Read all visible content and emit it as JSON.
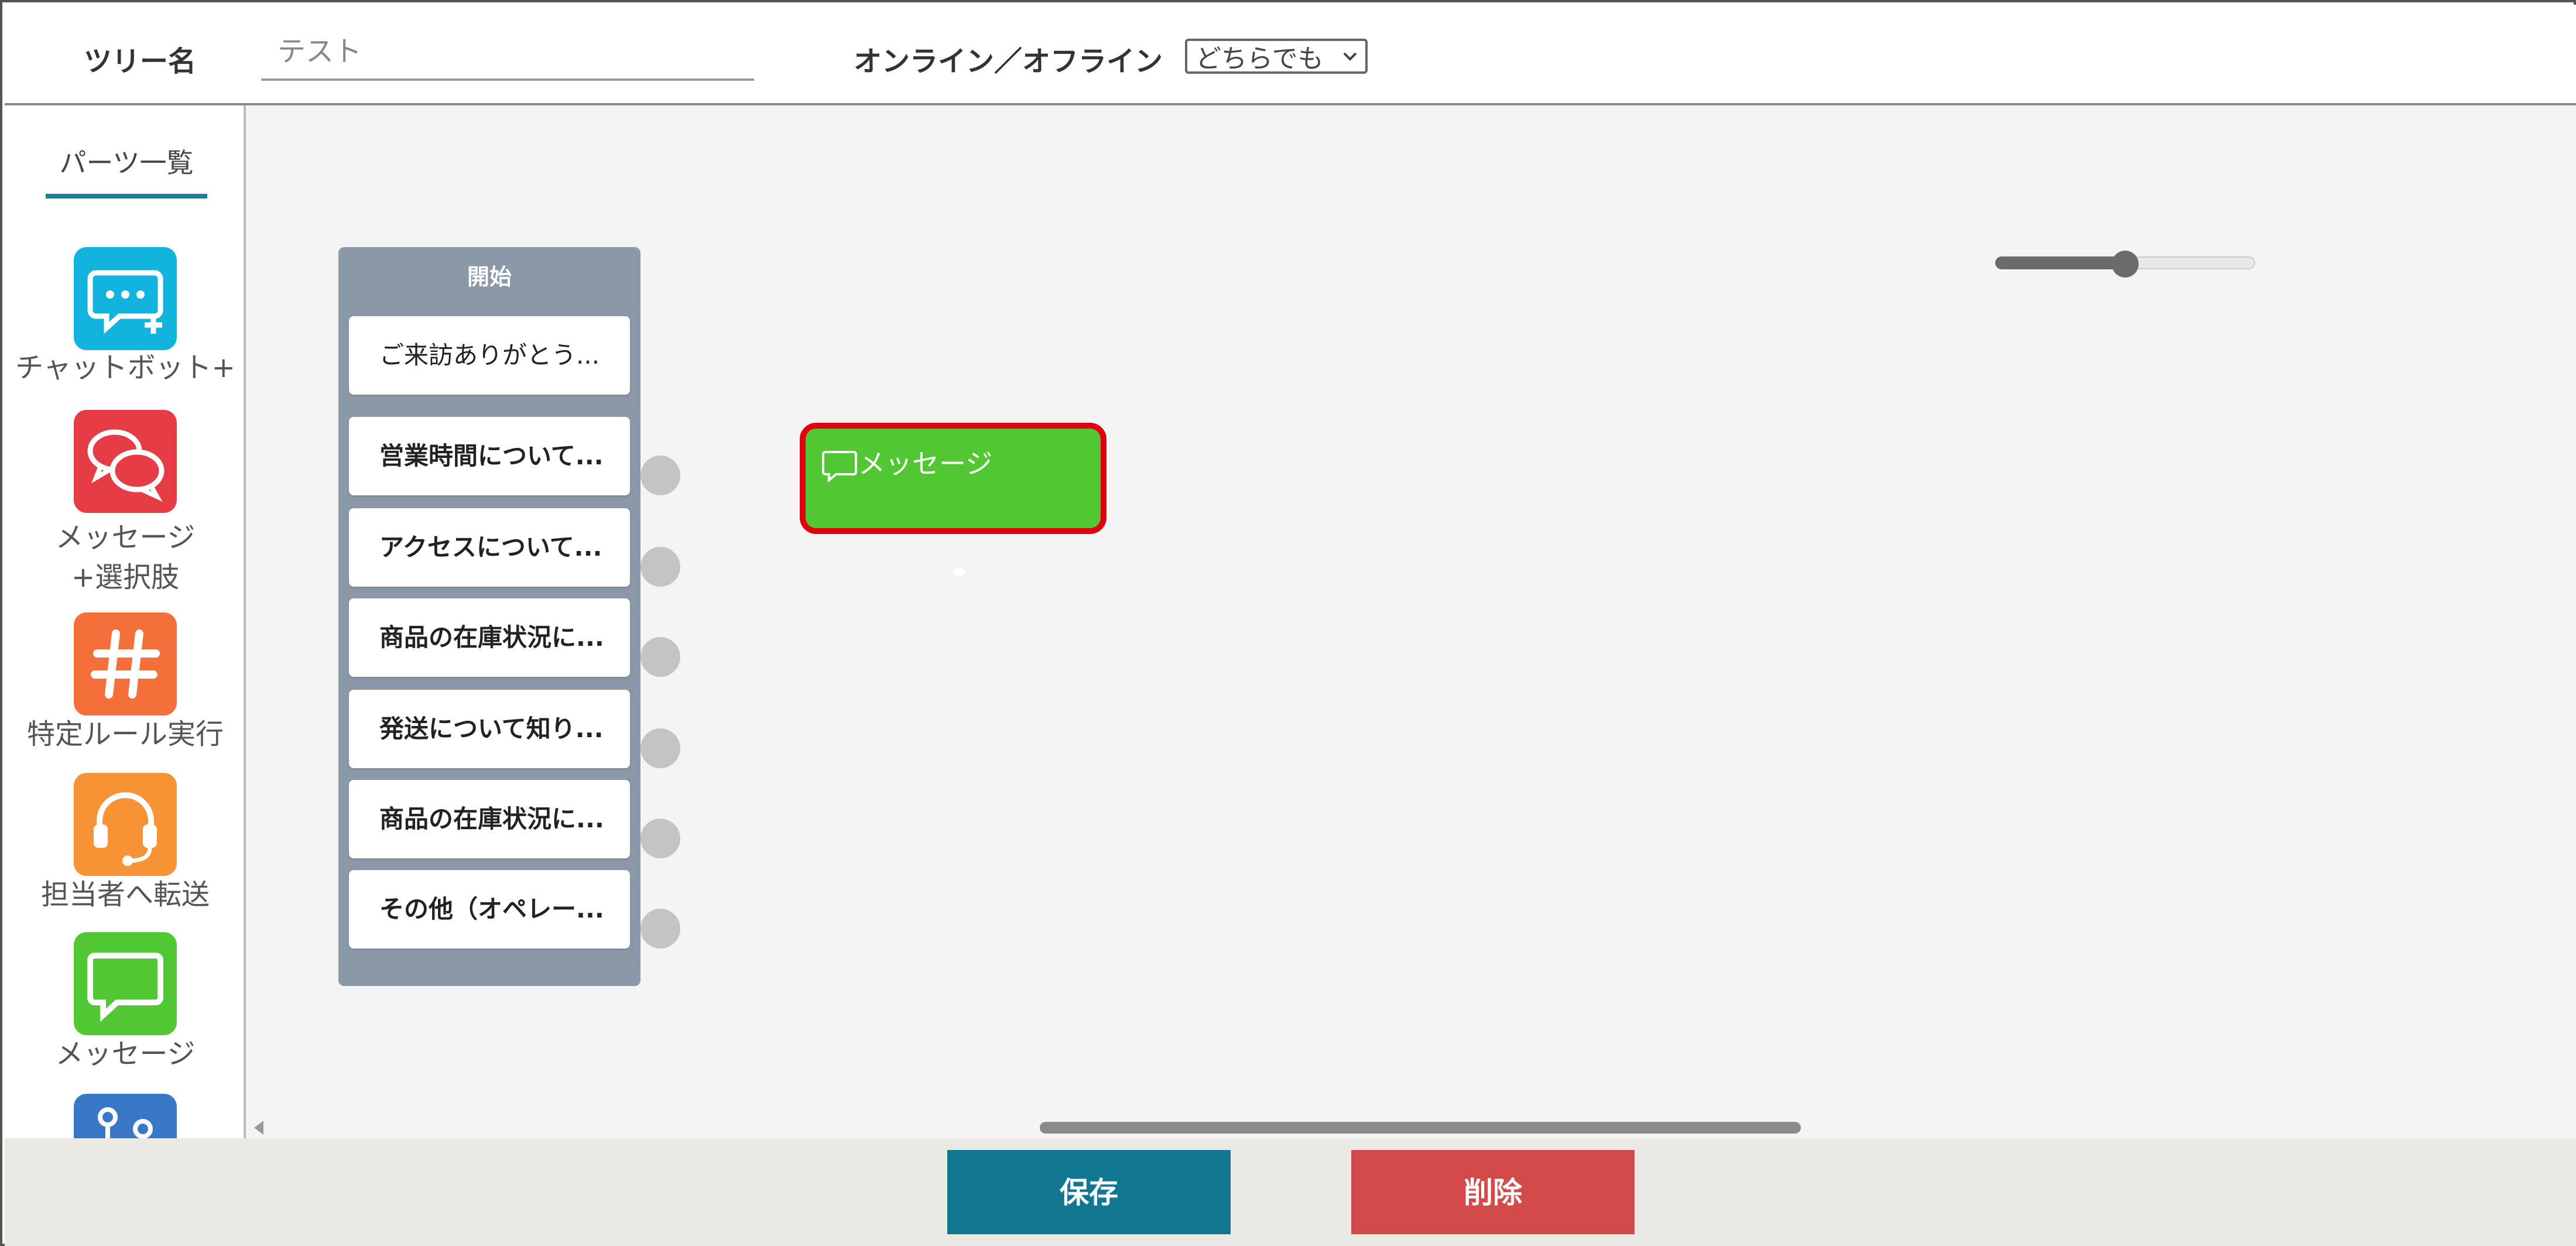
{
  "header": {
    "tree_name_label": "ツリー名",
    "tree_name_placeholder": "テスト",
    "online_label": "オンライン／オフライン",
    "online_select_value": "どちらでも"
  },
  "sidebar": {
    "title": "パーツ一覧",
    "items": [
      {
        "label": "チャットボット+",
        "icon": "chatbot-plus-icon",
        "color": "#12b4dd"
      },
      {
        "label_line1": "メッセージ",
        "label_line2": "+選択肢",
        "icon": "message-choice-icon",
        "color": "#e53c46"
      },
      {
        "label": "特定ルール実行",
        "icon": "hashtag-icon",
        "color": "#f46f3a"
      },
      {
        "label": "担当者へ転送",
        "icon": "headset-icon",
        "color": "#f79334"
      },
      {
        "label": "メッセージ",
        "icon": "message-icon",
        "color": "#52c734"
      },
      {
        "label": "",
        "icon": "branch-icon",
        "color": "#3a77c6"
      }
    ]
  },
  "canvas": {
    "start_block": {
      "title": "開始",
      "options": [
        "ご来訪ありがとう...",
        "営業時間について...",
        "アクセスについて...",
        "商品の在庫状況に...",
        "発送について知り...",
        "商品の在庫状況に...",
        "その他（オペレー..."
      ]
    },
    "message_node": {
      "label": "メッセージ",
      "color": "#52c734",
      "highlight": "#e00010"
    },
    "zoom_level": 0.5
  },
  "footer": {
    "save_label": "保存",
    "delete_label": "削除",
    "save_color": "#127891",
    "delete_color": "#d34a4a"
  }
}
